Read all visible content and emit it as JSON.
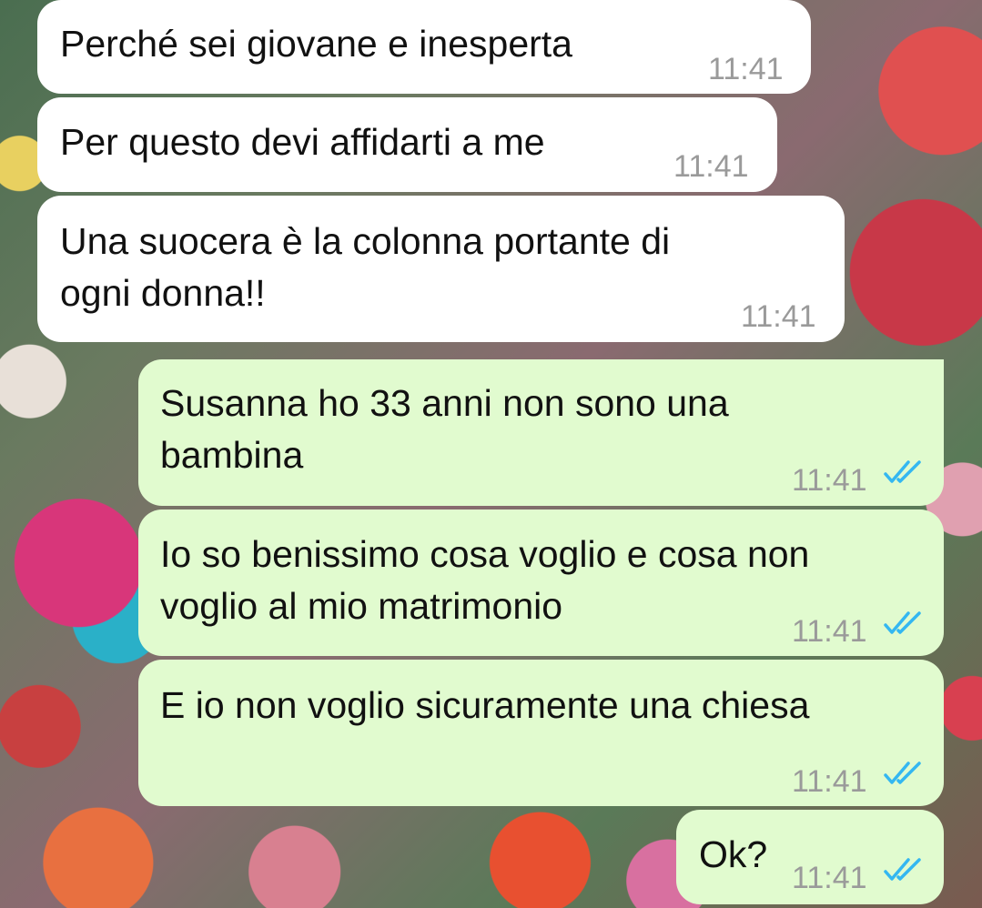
{
  "messages": [
    {
      "direction": "incoming",
      "lines": [
        "Perché sei giovane e inesperta"
      ],
      "time": "11:41"
    },
    {
      "direction": "incoming",
      "lines": [
        "Per questo devi affidarti a me"
      ],
      "time": "11:41"
    },
    {
      "direction": "incoming",
      "lines": [
        "Una suocera è la colonna portante di",
        "ogni donna!!"
      ],
      "time": "11:41"
    },
    {
      "direction": "outgoing",
      "lines": [
        "Susanna ho 33 anni non sono una",
        "bambina"
      ],
      "time": "11:41",
      "status": "read"
    },
    {
      "direction": "outgoing",
      "lines": [
        "Io so benissimo cosa voglio e cosa non",
        "voglio al mio matrimonio"
      ],
      "time": "11:41",
      "status": "read"
    },
    {
      "direction": "outgoing",
      "lines": [
        "E io non voglio sicuramente una chiesa"
      ],
      "time": "11:41",
      "status": "read"
    },
    {
      "direction": "outgoing",
      "lines": [
        "Ok?"
      ],
      "time": "11:41",
      "status": "read"
    }
  ],
  "colors": {
    "incoming_bubble": "#ffffff",
    "outgoing_bubble": "#e1fbcf",
    "timestamp": "#9a9a9a",
    "read_receipt": "#34b7f1"
  },
  "icons": {
    "read_receipt": "double-check-icon"
  }
}
